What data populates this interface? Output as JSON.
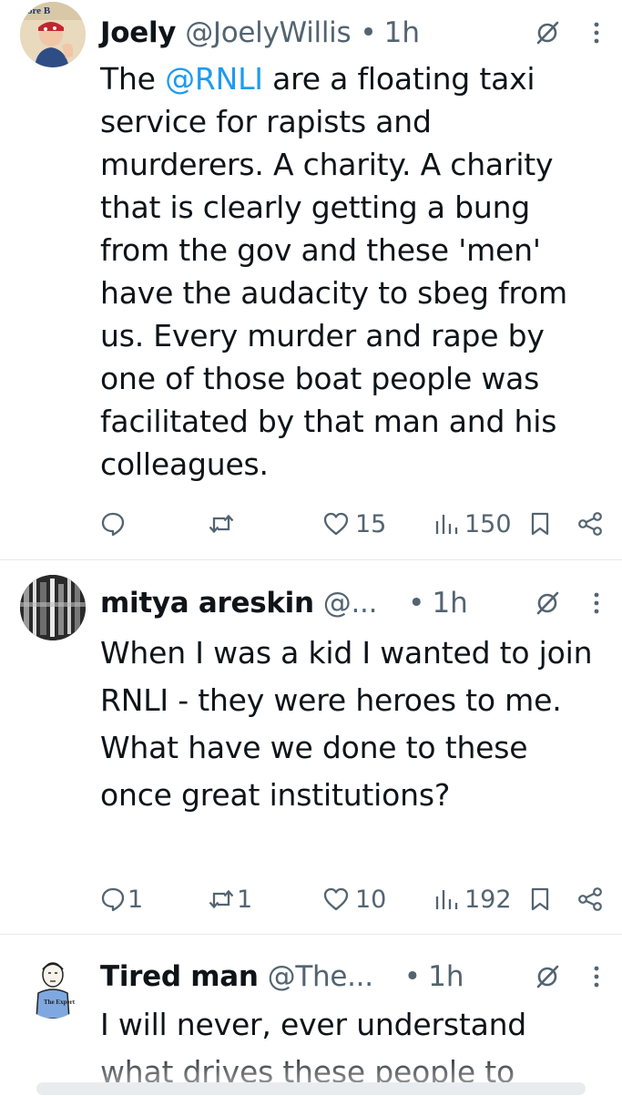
{
  "tweets": [
    {
      "name": "Joely",
      "handle": "@JoelyWillis",
      "dot": "•",
      "time": "1h",
      "avatar_text": "ore B",
      "text_before": "The ",
      "mention": "@RNLI",
      "text_after": " are a floating taxi service for rapists and murderers. A charity. A charity that is clearly getting a bung from the gov and these 'men' have the audacity to sbeg from us. Every murder and rape by one of those boat people was facilitated by that man and his colleagues.",
      "replies": "",
      "reposts": "",
      "likes": "15",
      "views": "150"
    },
    {
      "name": "mitya areskin",
      "handle": "@...",
      "dot": "•",
      "time": "1h",
      "lines": [
        "When I was a kid I wanted to join RNLI - they were heroes to me.",
        "What have we done to these once great institutions?"
      ],
      "replies": "1",
      "reposts": "1",
      "likes": "10",
      "views": "192"
    },
    {
      "name": "Tired man",
      "handle": "@The...",
      "dot": "•",
      "time": "1h",
      "avatar_text": "The Expert",
      "text": "I will never, ever understand what drives these people to"
    }
  ],
  "icons": {
    "reply": "reply-icon",
    "repost": "repost-icon",
    "like": "heart-icon",
    "views": "views-icon",
    "bookmark": "bookmark-icon",
    "share": "share-icon",
    "grok": "grok-icon",
    "more": "more-icon"
  },
  "colors": {
    "text": "#0f1419",
    "secondary": "#536471",
    "link": "#1d9bf0",
    "divider": "#e6e9ec"
  }
}
